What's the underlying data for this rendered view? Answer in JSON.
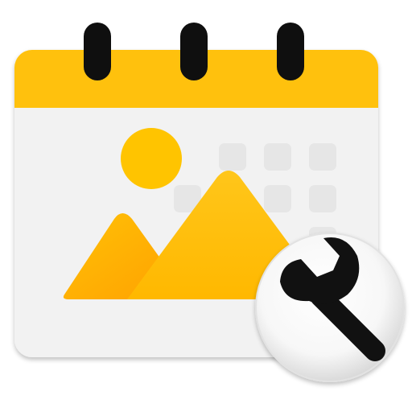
{
  "app_icon": {
    "icon_name": "calendar-photo-settings-icon",
    "parts": {
      "calendar": "calendar-icon",
      "rings": "binder-ring-icon",
      "photo": "image-icon",
      "sun": "sun-icon",
      "mountains": "mountain-icon",
      "badge": "wrench-icon"
    },
    "colors": {
      "header": "#FFC107",
      "header_shadow": "#FBB000",
      "card": "#F2F2F2",
      "card_edge": "#E6E6E6",
      "grid_cells": "#E4E4E4",
      "rings": "#0F0F0F",
      "sun": "#FFC400",
      "mountain_front": "#FFC107",
      "mountain_back": "#FFB300",
      "badge_fill": "#FAFAFA",
      "badge_ring": "#E0E0E0",
      "wrench": "#111111"
    }
  }
}
